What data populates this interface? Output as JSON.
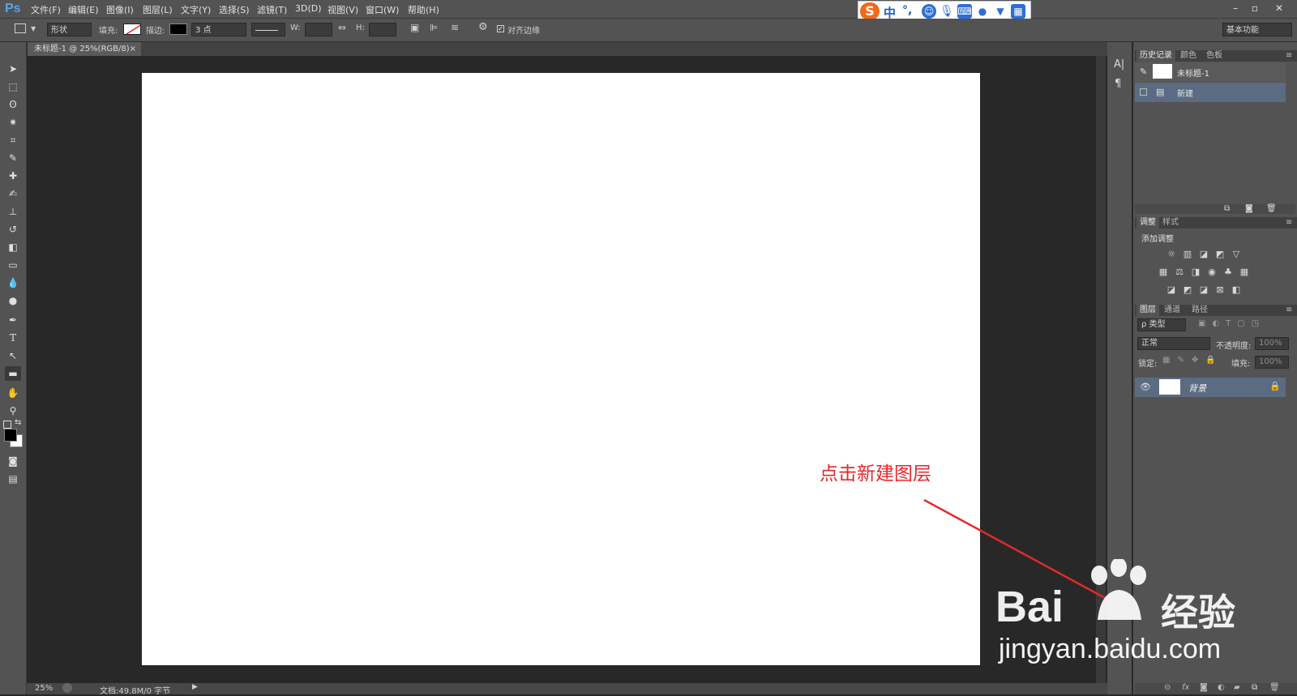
{
  "app": {
    "logo": "Ps"
  },
  "menu": [
    "文件(F)",
    "编辑(E)",
    "图像(I)",
    "图层(L)",
    "文字(Y)",
    "选择(S)",
    "滤镜(T)",
    "3D(D)",
    "视图(V)",
    "窗口(W)",
    "帮助(H)"
  ],
  "ime": {
    "logo": "S",
    "lang": "中",
    "punct": "°,",
    "icons": [
      "smiley-icon",
      "microphone-icon",
      "keyboard-icon",
      "user-icon",
      "shirt-icon",
      "grid-icon"
    ]
  },
  "window_controls": {
    "minimize": "–",
    "restore": "▫",
    "close": "✕"
  },
  "options": {
    "mode": "形状",
    "fill_label": "填充:",
    "stroke_label": "描边:",
    "stroke_size": "3 点",
    "w_label": "W:",
    "h_label": "H:",
    "align_edges": "对齐边缘",
    "workspace": "基本功能"
  },
  "document": {
    "tab_title": "未标题-1 @ 25%(RGB/8)",
    "tab_close": "×"
  },
  "status": {
    "zoom": "25%",
    "doc_info": "文档:49.8M/0 字节"
  },
  "history_panel": {
    "tabs": [
      "历史记录",
      "颜色",
      "色板"
    ],
    "snapshot": "未标题-1",
    "items": [
      "新建"
    ]
  },
  "adjust_panel": {
    "tabs": [
      "调整",
      "样式"
    ],
    "title": "添加调整"
  },
  "layers_panel": {
    "tabs": [
      "图层",
      "通道",
      "路径"
    ],
    "filter": "ρ 类型",
    "blend_mode": "正常",
    "opacity_label": "不透明度:",
    "opacity": "100%",
    "lock_label": "锁定:",
    "fill_label": "填充:",
    "fill": "100%",
    "layers": [
      {
        "name": "背景",
        "locked": true
      }
    ]
  },
  "annotation": {
    "text": "点击新建图层",
    "color": "#e22a2a"
  },
  "watermark": {
    "brand_left": "Bai",
    "brand_right": "经验",
    "url": "jingyan.baidu.com"
  },
  "colors": {
    "accent": "#5aa3e6",
    "selection": "#5b6b82",
    "annotation": "#e22a2a"
  }
}
